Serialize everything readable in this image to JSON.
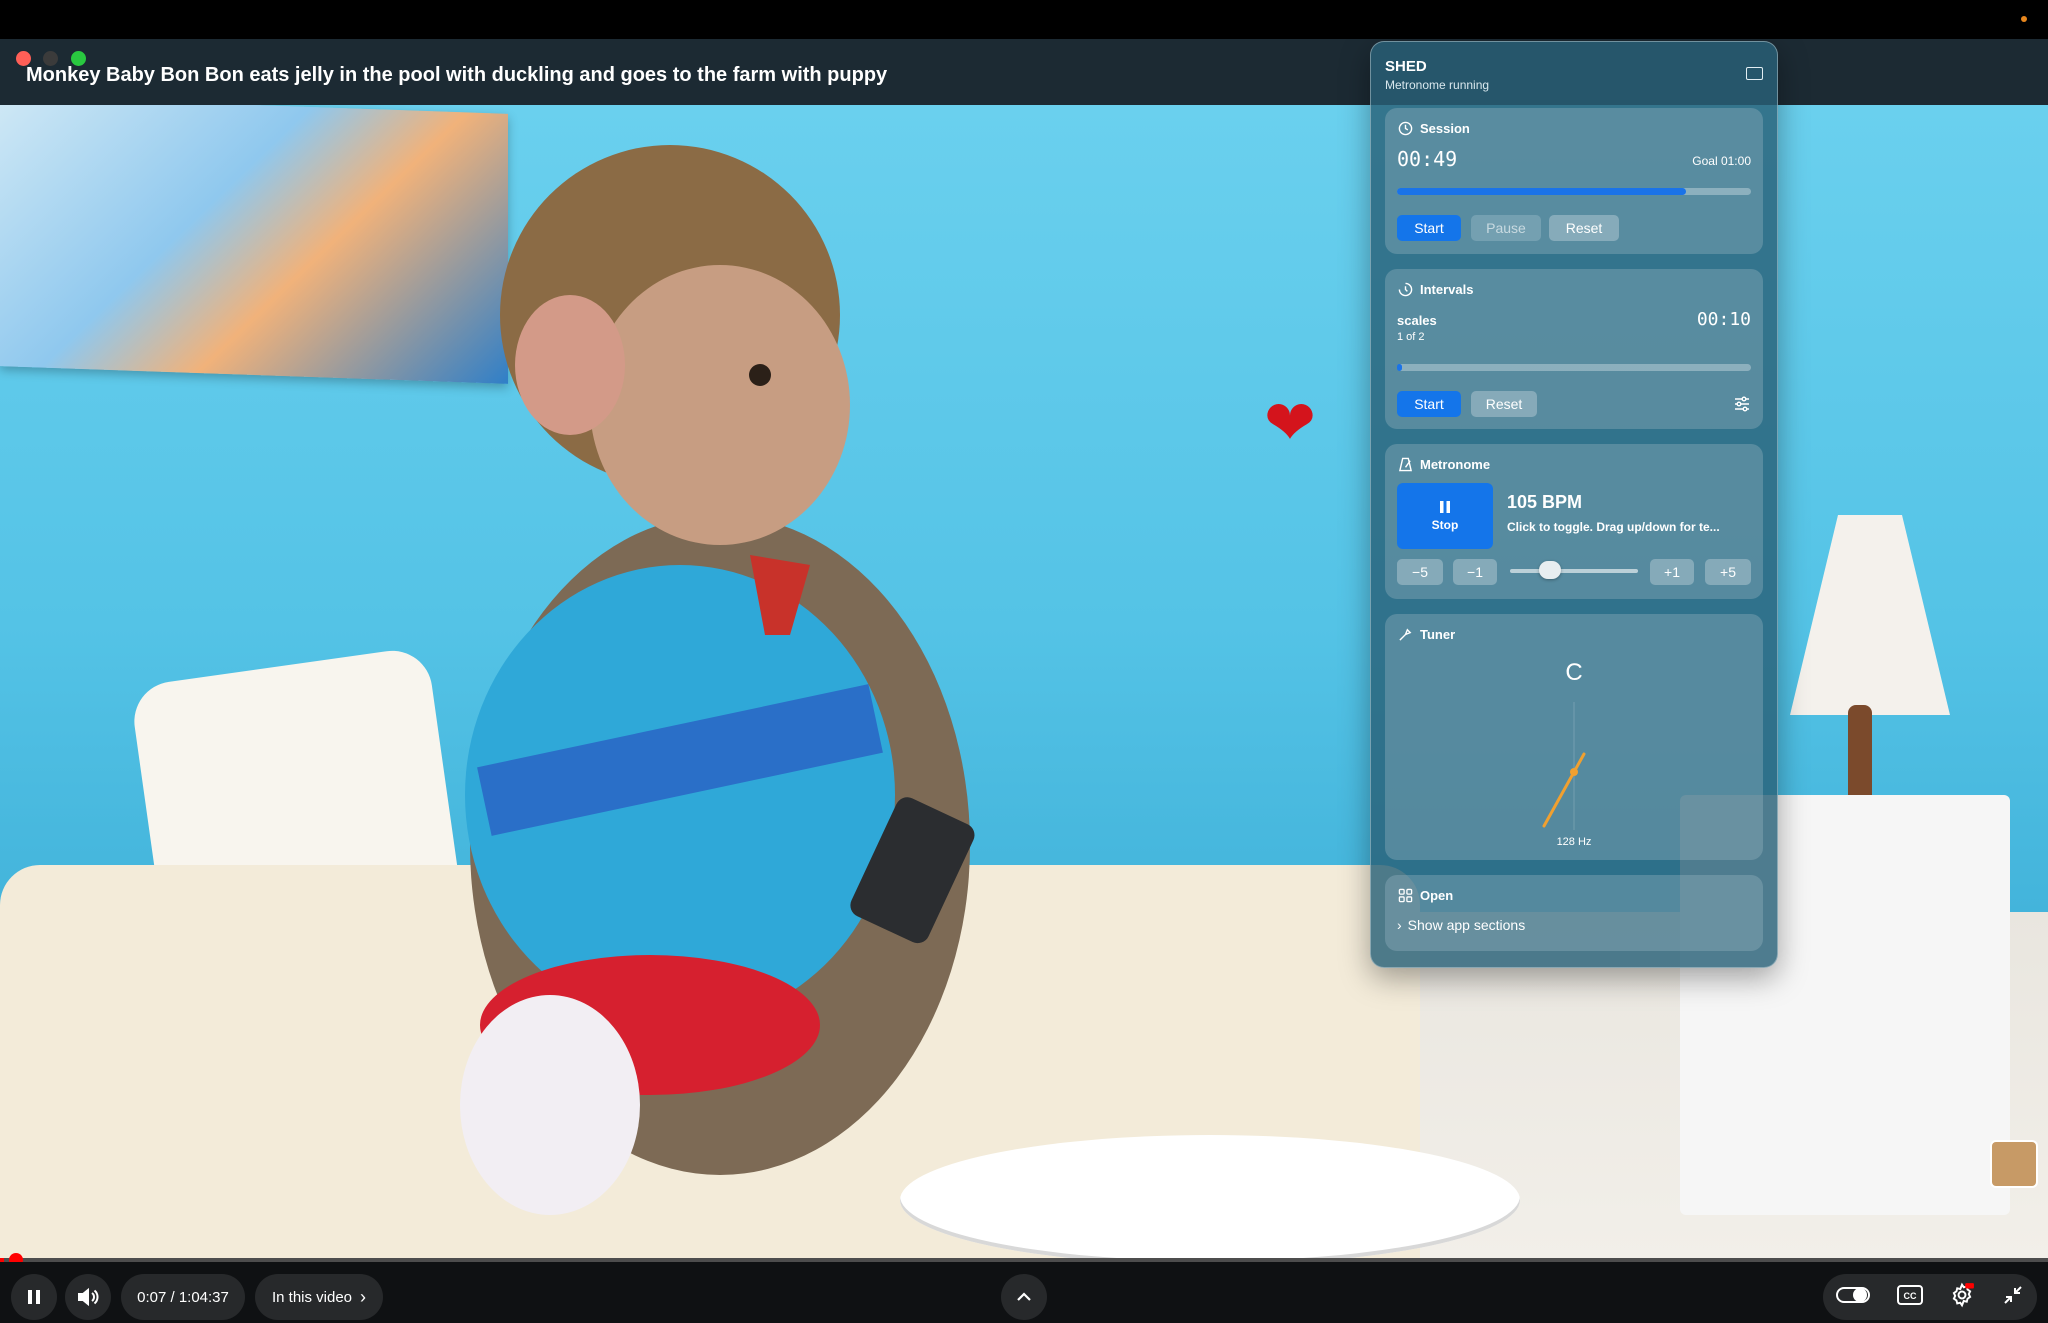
{
  "video": {
    "title": "Monkey Baby Bon Bon eats jelly in the pool with duckling and goes to the farm with puppy"
  },
  "player": {
    "time": "0:07 / 1:04:37",
    "in_this_video": "In this video",
    "progress_fraction": 0.0018
  },
  "shed": {
    "title": "SHED",
    "subtitle": "Metronome running",
    "session": {
      "label": "Session",
      "elapsed": "00:49",
      "goal": "Goal 01:00",
      "progress_fraction": 0.816,
      "start": "Start",
      "pause": "Pause",
      "reset": "Reset"
    },
    "intervals": {
      "label": "Intervals",
      "name": "scales",
      "count": "1 of 2",
      "time": "00:10",
      "progress_fraction": 0.01,
      "start": "Start",
      "reset": "Reset"
    },
    "metronome": {
      "label": "Metronome",
      "toggle": "Stop",
      "bpm": "105 BPM",
      "hint": "Click to toggle. Drag up/down for te...",
      "minus5": "−5",
      "minus1": "−1",
      "plus1": "+1",
      "plus5": "+5",
      "tempo_fraction": 0.27
    },
    "tuner": {
      "label": "Tuner",
      "note": "C",
      "freq": "128 Hz"
    },
    "open": {
      "label": "Open",
      "show": "Show app sections"
    }
  },
  "colors": {
    "accent": "#1475ea",
    "youtube_red": "#ff0000",
    "tuner_needle": "#f0a030"
  }
}
